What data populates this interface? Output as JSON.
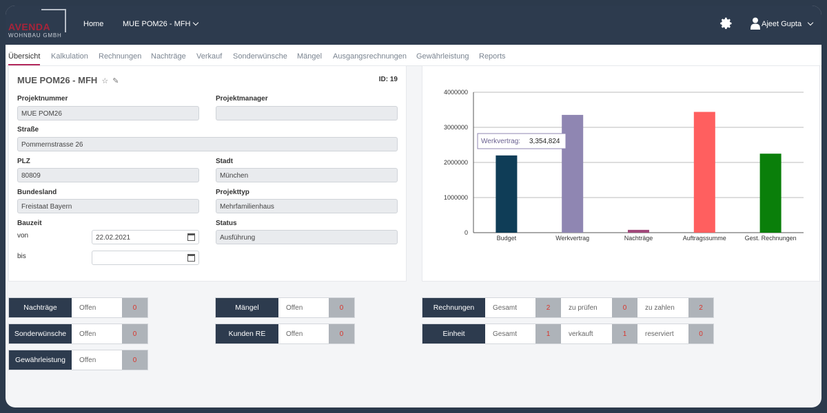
{
  "brand": {
    "name": "AVENDA",
    "sub": "WOHNBAU GMBH"
  },
  "nav": {
    "home": "Home",
    "project_menu": "MUE POM26 - MFH",
    "user": "Ajeet Gupta"
  },
  "tabs": [
    "Übersicht",
    "Kalkulation",
    "Rechnungen",
    "Nachträge",
    "Verkauf",
    "Sonderwünsche",
    "Mängel",
    "Ausgangsrechnungen",
    "Gewährleistung",
    "Reports"
  ],
  "project": {
    "title": "MUE POM26 - MFH",
    "id_label": "ID: 19",
    "projektnummer_label": "Projektnummer",
    "projektnummer": "MUE POM26",
    "projektmanager_label": "Projektmanager",
    "projektmanager": "",
    "strasse_label": "Straße",
    "strasse": "Pommernstrasse 26",
    "plz_label": "PLZ",
    "plz": "80809",
    "stadt_label": "Stadt",
    "stadt": "München",
    "bundesland_label": "Bundesland",
    "bundesland": "Freistaat Bayern",
    "projekttyp_label": "Projekttyp",
    "projekttyp": "Mehrfamilienhaus",
    "bauzeit_label": "Bauzeit",
    "von_label": "von",
    "von": "22.02.2021",
    "bis_label": "bis",
    "bis": "",
    "status_label": "Status",
    "status": "Ausführung"
  },
  "chart_data": {
    "type": "bar",
    "categories": [
      "Budget",
      "Werkvertrag",
      "Nachträge",
      "Auftragssumme",
      "Gest. Rechnungen"
    ],
    "values": [
      2200000,
      3354824,
      80000,
      3440000,
      2250000
    ],
    "colors": [
      "#0f3d57",
      "#8f86b2",
      "#a1477a",
      "#ff5f5f",
      "#0a7f0a"
    ],
    "ylim": [
      0,
      4000000
    ],
    "yticks": [
      "0",
      "1000000",
      "2000000",
      "3000000",
      "4000000"
    ],
    "grid": true,
    "tooltip": {
      "label": "Werkvertrag:",
      "value": "3,354,824"
    }
  },
  "widgets": {
    "nachtraege": {
      "head": "Nachträge",
      "text": "Offen",
      "num": "0"
    },
    "sonderwuensche": {
      "head": "Sonderwünsche",
      "text": "Offen",
      "num": "0"
    },
    "gewaehrleistung": {
      "head": "Gewährleistung",
      "text": "Offen",
      "num": "0"
    },
    "maengel": {
      "head": "Mängel",
      "text": "Offen",
      "num": "0"
    },
    "kunden_re": {
      "head": "Kunden RE",
      "text": "Offen",
      "num": "0"
    },
    "rechnungen": {
      "head": "Rechnungen",
      "t1": "Gesamt",
      "n1": "2",
      "t2": "zu prüfen",
      "n2": "0",
      "t3": "zu zahlen",
      "n3": "2"
    },
    "einheit": {
      "head": "Einheit",
      "t1": "Gesamt",
      "n1": "1",
      "t2": "verkauft",
      "n2": "1",
      "t3": "reserviert",
      "n3": "0"
    }
  }
}
